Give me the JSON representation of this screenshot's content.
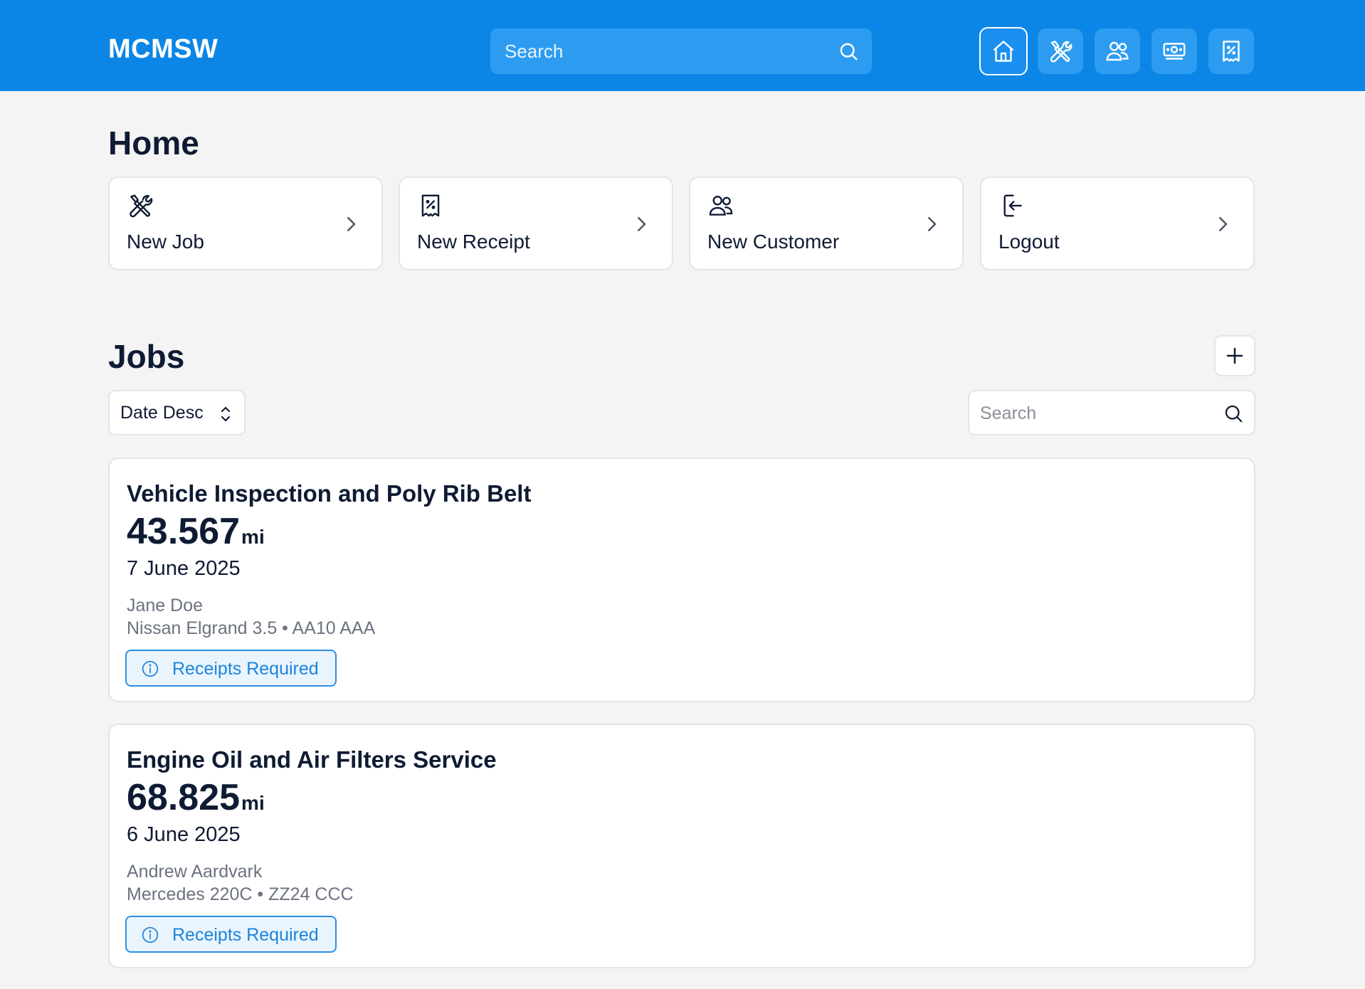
{
  "header": {
    "brand": "MCMSW",
    "search_placeholder": "Search",
    "nav": [
      {
        "icon": "home-icon",
        "active": true
      },
      {
        "icon": "tools-icon",
        "active": false
      },
      {
        "icon": "users-icon",
        "active": false
      },
      {
        "icon": "money-icon",
        "active": false
      },
      {
        "icon": "receipt-icon",
        "active": false
      }
    ]
  },
  "home": {
    "title": "Home",
    "actions": [
      {
        "label": "New Job",
        "icon": "tools-icon"
      },
      {
        "label": "New Receipt",
        "icon": "receipt-icon"
      },
      {
        "label": "New Customer",
        "icon": "users-icon"
      },
      {
        "label": "Logout",
        "icon": "logout-icon"
      }
    ]
  },
  "jobs": {
    "title": "Jobs",
    "sort_value": "Date Desc",
    "search_placeholder": "Search",
    "items": [
      {
        "title": "Vehicle Inspection and Poly Rib Belt",
        "mileage": "43.567",
        "unit": "mi",
        "date": "7 June 2025",
        "customer": "Jane Doe",
        "vehicle": "Nissan Elgrand 3.5 • AA10 AAA",
        "badge": "Receipts Required"
      },
      {
        "title": "Engine Oil and Air Filters Service",
        "mileage": "68.825",
        "unit": "mi",
        "date": "6 June 2025",
        "customer": "Andrew Aardvark",
        "vehicle": "Mercedes 220C • ZZ24 CCC",
        "badge": "Receipts Required"
      }
    ]
  },
  "colors": {
    "header_bg": "#0b86e6",
    "accent": "#1b84dc",
    "page_bg": "#f4f4f5"
  }
}
